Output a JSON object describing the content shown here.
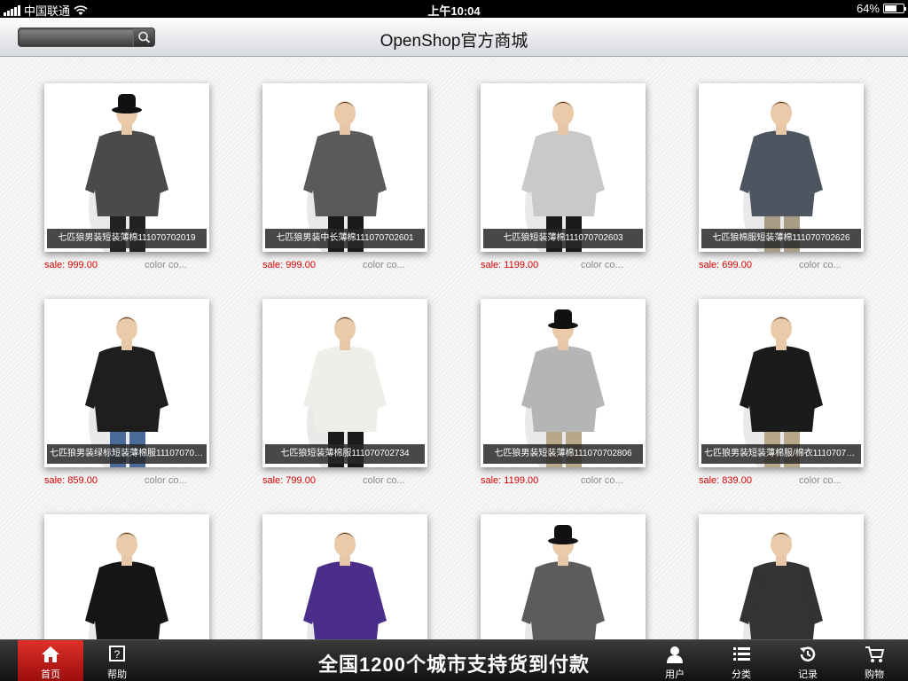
{
  "status_bar": {
    "carrier": "中国联通",
    "time": "上午10:04",
    "battery": "64%",
    "battery_level": 0.64
  },
  "nav": {
    "title": "OpenShop官方商城",
    "search_placeholder": ""
  },
  "products": [
    {
      "name": "七匹狼男装短装薄棉111070702019",
      "price": "sale: 999.00",
      "color": "color co...",
      "shirt": "#4a4a4a",
      "pants": "#222",
      "hat": true
    },
    {
      "name": "七匹狼男装中长薄棉111070702601",
      "price": "sale: 999.00",
      "color": "color co...",
      "shirt": "#5a5a5a",
      "pants": "#1a1a1a",
      "hat": false
    },
    {
      "name": "七匹狼短装薄棉111070702603",
      "price": "sale: 1199.00",
      "color": "color co...",
      "shirt": "#c9c9c9",
      "pants": "#1a1a1a",
      "hat": false
    },
    {
      "name": "七匹狼棉服短装薄棉111070702626",
      "price": "sale: 699.00",
      "color": "color co...",
      "shirt": "#4d5560",
      "pants": "#a89c84",
      "hat": false
    },
    {
      "name": "七匹狼男装绿标短装薄棉服111070702...",
      "price": "sale: 859.00",
      "color": "color co...",
      "shirt": "#1e1e1e",
      "pants": "#4a6a9a",
      "hat": false
    },
    {
      "name": "七匹狼短装薄棉服111070702734",
      "price": "sale: 799.00",
      "color": "color co...",
      "shirt": "#efefea",
      "pants": "#1a1a1a",
      "hat": false
    },
    {
      "name": "七匹狼男装短装薄棉111070702806",
      "price": "sale: 1199.00",
      "color": "color co...",
      "shirt": "#b5b5b5",
      "pants": "#b8a88a",
      "hat": true
    },
    {
      "name": "七匹狼男装短装薄棉服/棉衣11107070...",
      "price": "sale: 839.00",
      "color": "color co...",
      "shirt": "#1b1b1b",
      "pants": "#b8a88a",
      "hat": false
    },
    {
      "name": "",
      "price": "",
      "color": "",
      "shirt": "#151515",
      "pants": "#111",
      "hat": false
    },
    {
      "name": "",
      "price": "",
      "color": "",
      "shirt": "#4b2d8a",
      "pants": "#111",
      "hat": false
    },
    {
      "name": "",
      "price": "",
      "color": "",
      "shirt": "#5c5c5c",
      "pants": "#111",
      "hat": true
    },
    {
      "name": "",
      "price": "",
      "color": "",
      "shirt": "#333",
      "pants": "#111",
      "hat": false
    }
  ],
  "tabs": [
    {
      "label": "首页",
      "icon": "home-icon",
      "active": true
    },
    {
      "label": "帮助",
      "icon": "help-icon",
      "active": false
    },
    {
      "label": "用户",
      "icon": "user-icon",
      "active": false
    },
    {
      "label": "分类",
      "icon": "list-icon",
      "active": false
    },
    {
      "label": "记录",
      "icon": "history-icon",
      "active": false
    },
    {
      "label": "购物",
      "icon": "cart-icon",
      "active": false
    }
  ],
  "slogan": "全国1200个城市支持货到付款",
  "colors": {
    "accent": "#d40000",
    "tab_active": "#c8201b"
  }
}
